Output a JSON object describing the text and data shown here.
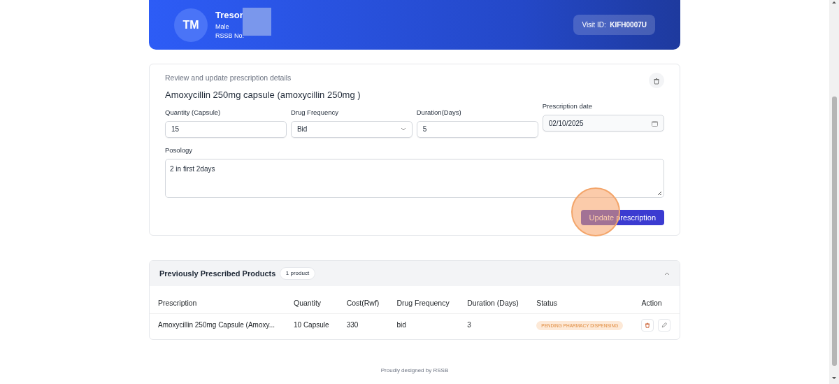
{
  "patient": {
    "initials": "TM",
    "name": "Tresor",
    "gender": "Male",
    "rssb_label": "RSSB No:",
    "visit_label": "Visit ID:",
    "visit_id": "KIFH0007U"
  },
  "form": {
    "subtitle": "Review and update prescription details",
    "drug": "Amoxycillin 250mg capsule (amoxycillin 250mg )",
    "fields": [
      {
        "kind": "input",
        "label": "Quantity (Capsule)",
        "value": "15"
      },
      {
        "kind": "select",
        "label": "Drug Frequency",
        "value": "Bid"
      },
      {
        "kind": "input",
        "label": "Duration(Days)",
        "value": "5"
      },
      {
        "kind": "date",
        "label": "Prescription date",
        "value": "02/10/2025"
      }
    ],
    "posology": {
      "label": "Posology",
      "value": "2 in first 2days"
    },
    "submit": "Update prescription"
  },
  "previous": {
    "title": "Previously Prescribed Products",
    "count": "1 product",
    "expanded": true,
    "columns": [
      "Prescription",
      "Quantity",
      "Cost(Rwf)",
      "Drug Frequency",
      "Duration (Days)",
      "Status",
      "Action"
    ],
    "rows": [
      {
        "prescription": "Amoxycillin 250mg Capsule (Amoxy...",
        "quantity": "10 Capsule",
        "cost": "330",
        "frequency": "bid",
        "duration": "3",
        "status": "PENDING PHARMACY DISPENSING"
      }
    ]
  },
  "footer": {
    "designed": "Proudly designed by RSSB"
  }
}
